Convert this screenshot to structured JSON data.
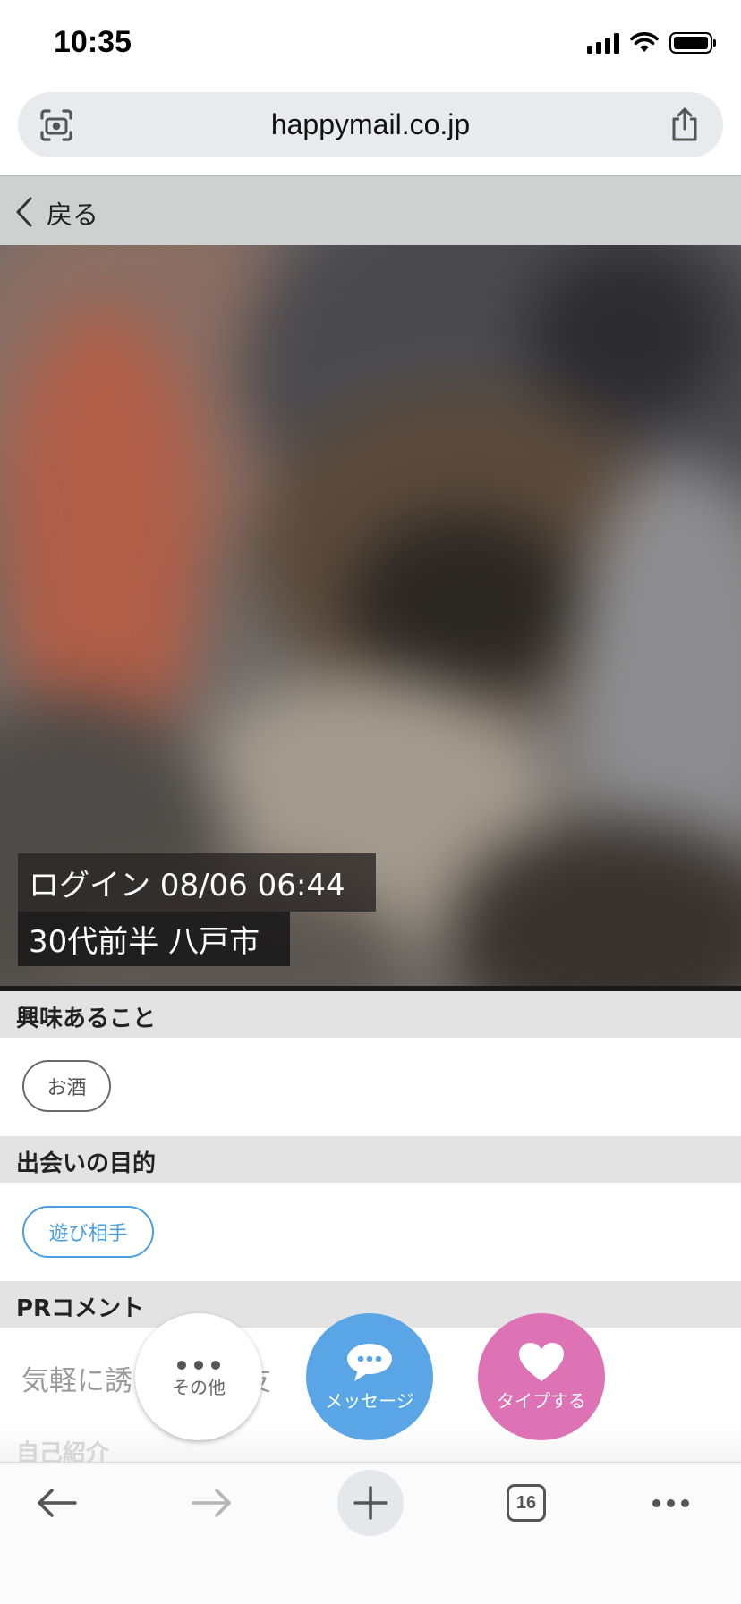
{
  "status_bar": {
    "time": "10:35",
    "icons": [
      "cellular-signal-icon",
      "wifi-icon",
      "battery-icon"
    ]
  },
  "browser": {
    "url": "happymail.co.jp",
    "icons": [
      "visual-search-icon",
      "share-icon"
    ]
  },
  "page": {
    "back_label": "戻る",
    "photo": {
      "login": "ログイン 08/06 06:44",
      "meta": "30代前半 八戸市"
    },
    "sections": {
      "interests": {
        "title": "興味あること",
        "tags": [
          "お酒"
        ]
      },
      "purpose": {
        "title": "出会いの目的",
        "tags": [
          "遊び相手"
        ]
      },
      "pr": {
        "title": "PRコメント",
        "text": "気軽に誘　　　み友　　い"
      },
      "intro": {
        "title": "自己紹介"
      }
    }
  },
  "actions": {
    "other": "その他",
    "message": "メッセージ",
    "like": "タイプする"
  },
  "toolbar": {
    "tab_count": "16",
    "icons": [
      "back-arrow-icon",
      "forward-arrow-icon",
      "new-tab-icon",
      "tabs-icon",
      "more-icon"
    ]
  },
  "colors": {
    "accent_blue": "#5aa5e6",
    "accent_pink": "#dd72b5",
    "chip_blue": "#4a9fe0",
    "section_header": "#e3e3e3"
  }
}
